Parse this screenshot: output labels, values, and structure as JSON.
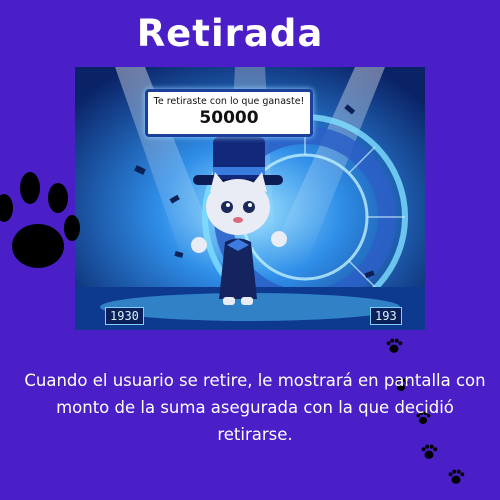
{
  "title": "Retirada",
  "screen": {
    "message": "Te retiraste con lo que ganaste!",
    "amount": "50000",
    "left_counter": "1930",
    "right_counter": "193"
  },
  "caption": "Cuando el usuario se retire,  le mostrará en pantalla con monto de la suma asegurada con la que decidió retirarse.",
  "colors": {
    "background": "#4a1fc8",
    "title": "#ffffff",
    "caption": "#ffffff",
    "paw": "#000000"
  },
  "icons": [
    "large-paw-icon",
    "small-paw-icon",
    "top-hat-cat-illustration"
  ]
}
